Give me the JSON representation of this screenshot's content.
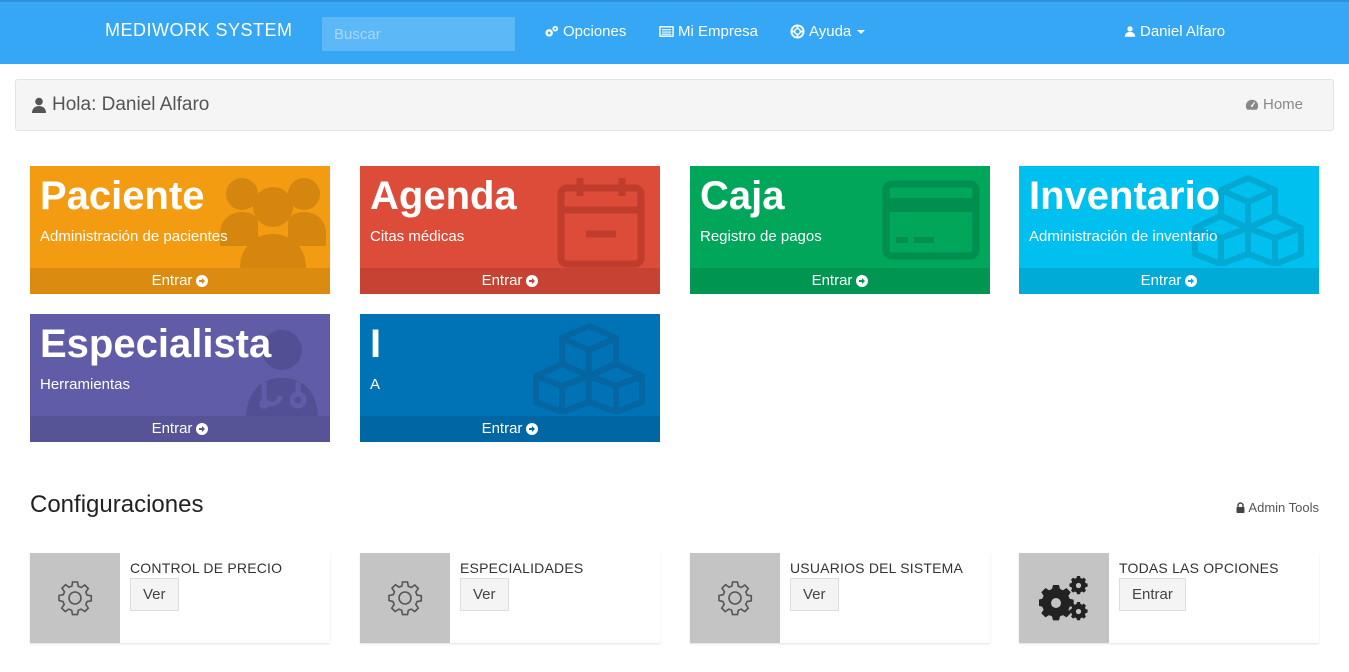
{
  "navbar": {
    "brand": "MEDIWORK SYSTEM",
    "search_placeholder": "Buscar",
    "opciones": "Opciones",
    "empresa": "Mi Empresa",
    "ayuda": "Ayuda",
    "user": "Daniel Alfaro"
  },
  "breadcrumb": {
    "greeting": "Hola: Daniel Alfaro",
    "home": "Home"
  },
  "tiles": [
    {
      "title": "Paciente",
      "subtitle": "Administración de pacientes",
      "footer": "Entrar",
      "icon": "users-icon",
      "color": "#f39c12"
    },
    {
      "title": "Agenda",
      "subtitle": "Citas médicas",
      "footer": "Entrar",
      "icon": "calendar-icon",
      "color": "#dd4b39"
    },
    {
      "title": "Caja",
      "subtitle": "Registro de pagos",
      "footer": "Entrar",
      "icon": "credit-card-icon",
      "color": "#00a65a"
    },
    {
      "title": "Inventario",
      "subtitle": "Administración de inventario",
      "footer": "Entrar",
      "icon": "cubes-icon",
      "color": "#00c0ef"
    },
    {
      "title": "Especialista",
      "subtitle": "Herramientas",
      "footer": "Entrar",
      "icon": "user-md-icon",
      "color": "#605ca8"
    },
    {
      "title": "I",
      "subtitle": "A",
      "footer": "Entrar",
      "icon": "cubes-icon",
      "color": "#0073b7"
    }
  ],
  "config": {
    "title": "Configuraciones",
    "admin_tools": "Admin Tools",
    "items": [
      {
        "label": "CONTROL DE PRECIO",
        "button": "Ver",
        "icon": "gear-icon"
      },
      {
        "label": "ESPECIALIDADES",
        "button": "Ver",
        "icon": "gear-icon"
      },
      {
        "label": "USUARIOS DEL SISTEMA",
        "button": "Ver",
        "icon": "gear-icon"
      },
      {
        "label": "TODAS LAS OPCIONES",
        "button": "Entrar",
        "icon": "gears-icon"
      }
    ]
  }
}
